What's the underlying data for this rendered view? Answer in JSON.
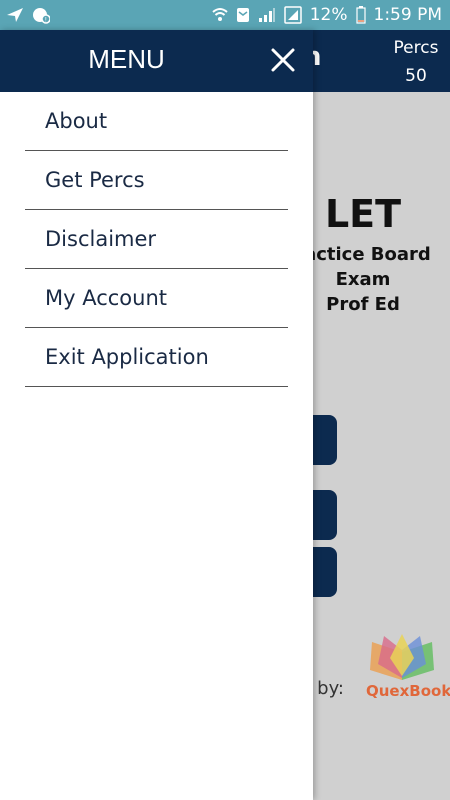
{
  "status_bar": {
    "battery_percent": "12%",
    "time": "1:59 PM"
  },
  "app": {
    "title_partial": "n",
    "percs_label": "Percs",
    "percs_value": "50",
    "big_title": "LET",
    "subtitle_lines": [
      "ractice Board",
      "Exam",
      "Prof Ed"
    ],
    "powered_by_partial": "d by:",
    "logo_text": "QuexBook"
  },
  "drawer": {
    "title": "MENU",
    "items": [
      {
        "label": "About"
      },
      {
        "label": "Get Percs"
      },
      {
        "label": "Disclaimer"
      },
      {
        "label": "My Account"
      },
      {
        "label": "Exit Application"
      }
    ]
  },
  "colors": {
    "status_bar": "#5aa5b5",
    "header": "#0c2a4f",
    "background": "#d0d0d0",
    "logo_text": "#e0673a"
  }
}
